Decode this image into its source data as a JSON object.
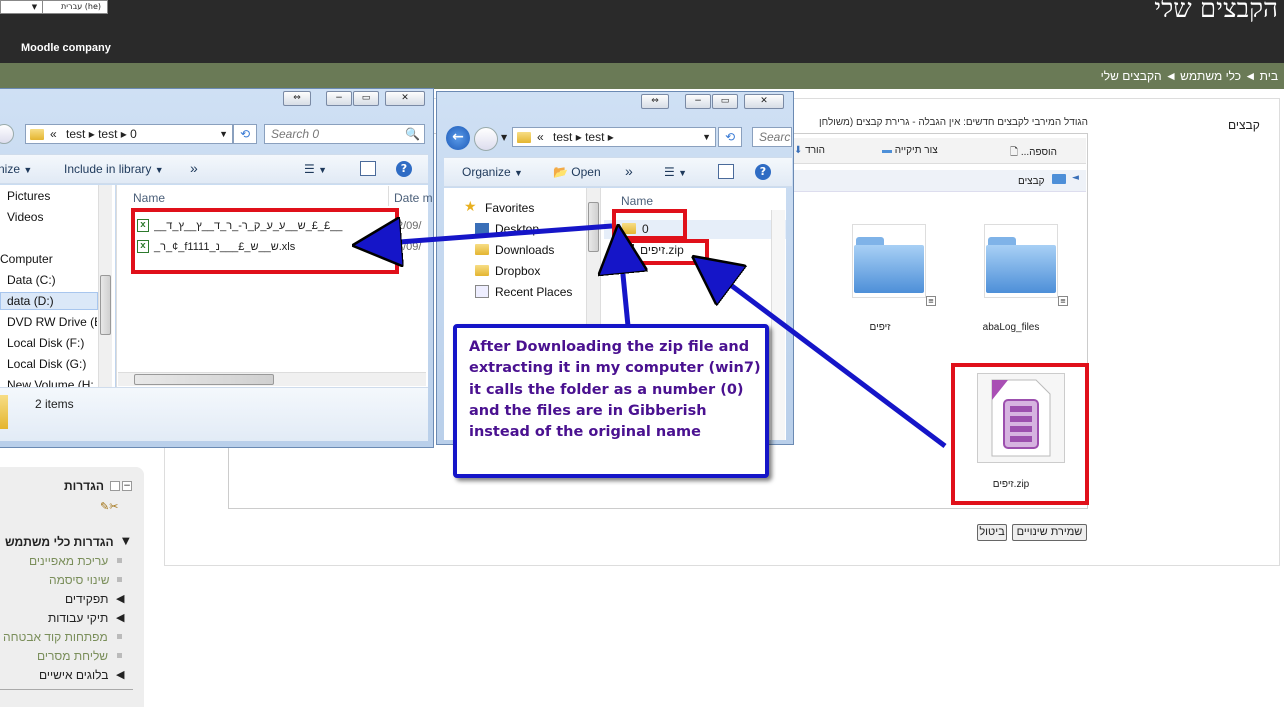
{
  "lang_selector": {
    "value": "עברית (he)"
  },
  "site": {
    "title": "הקבצים שלי",
    "company": "Moodle company"
  },
  "breadcrumb": "בית ◄ כלי משתמש ◄ הקבצים שלי",
  "main": {
    "files_label": "קבצים",
    "upload_info": "הגודל המירבי לקבצים חדשים: אין הגבלה - גרירת קבצים (משולחן",
    "toolbar": {
      "add": "הוספה...",
      "new_folder": "צור תיקייה",
      "download": "הורד"
    },
    "path_root": "קבצים",
    "folders": [
      {
        "name": "זיפים"
      },
      {
        "name": "abaLog_files"
      }
    ],
    "zip_file": {
      "name": "זיפים.zip"
    },
    "buttons": {
      "cancel": "ביטול",
      "save": "שמירת שינויים"
    }
  },
  "settings": {
    "title": "הגדרות",
    "section": "הגדרות כלי משתמש",
    "items": [
      {
        "label": "עריכת מאפיינים",
        "type": "link"
      },
      {
        "label": "שינוי סיסמה",
        "type": "link"
      },
      {
        "label": "תפקידים",
        "type": "expand"
      },
      {
        "label": "תיקי עבודות",
        "type": "expand"
      },
      {
        "label": "מפתחות קוד אבטחה",
        "type": "link"
      },
      {
        "label": "שליחת מסרים",
        "type": "link"
      },
      {
        "label": "בלוגים אישיים",
        "type": "expand"
      }
    ]
  },
  "explorer_left": {
    "address": [
      "test",
      "test",
      "0"
    ],
    "search_placeholder": "Search 0",
    "toolbar": {
      "organize": "nize",
      "include": "Include in library",
      "more": "»"
    },
    "nav": [
      "Pictures",
      "Videos",
      "Computer",
      "Data (C:)",
      "data (D:)",
      "DVD RW Drive (E:",
      "Local Disk (F:)",
      "Local Disk (G:)",
      "New Volume (H:"
    ],
    "col_name": "Name",
    "col_date": "Date m",
    "files": [
      {
        "name": "__ש__ע_ע_ק_ר-_ר_ד__ץ__ץ_ד_£_£__",
        "date": "2/09/"
      },
      {
        "name": "_ר_¢_f1111_ש__ש_£___נ.xls",
        "date": "2/09/"
      }
    ],
    "status": "2 items"
  },
  "explorer_right": {
    "address": [
      "test",
      "test"
    ],
    "search_placeholder": "Searc",
    "toolbar": {
      "organize": "Organize",
      "open": "Open",
      "more": "»"
    },
    "favorites": "Favorites",
    "nav": [
      "Desktop",
      "Downloads",
      "Dropbox",
      "Recent Places"
    ],
    "col_name": "Name",
    "files": [
      {
        "name": "0"
      },
      {
        "name": "זיפים.zip"
      }
    ]
  },
  "callout": {
    "text": "After Downloading the zip file and extracting it in my computer (win7) it calls the folder as a number (0) and the files are in Gibberish instead of the original name"
  },
  "colors": {
    "annotation_red": "#e0101a",
    "annotation_blue": "#1515c8",
    "callout_text": "#4a1190",
    "moodle_nav": "#6a7a56"
  }
}
